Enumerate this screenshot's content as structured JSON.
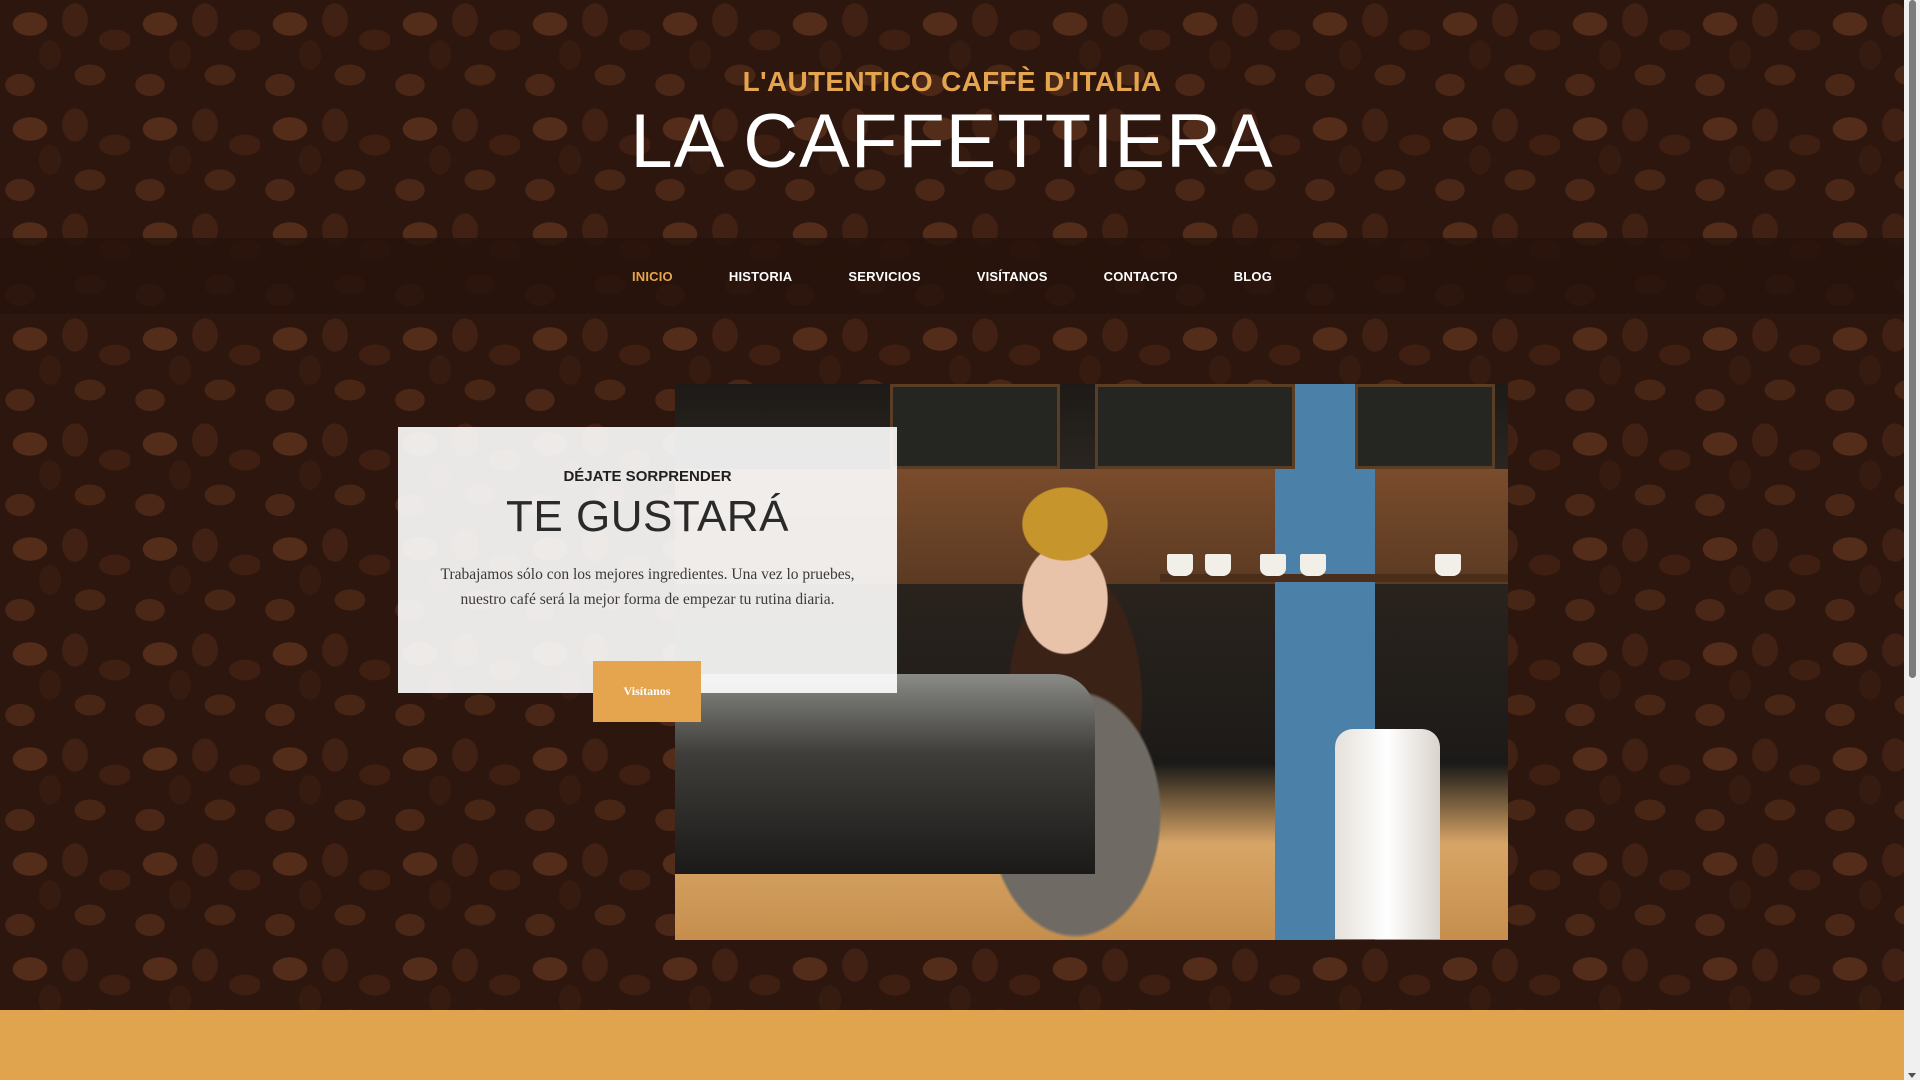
{
  "header": {
    "tagline": "L'AUTENTICO CAFFÈ D'ITALIA",
    "title": "LA CAFFETTIERA"
  },
  "nav": {
    "items": [
      {
        "label": "INICIO",
        "active": true
      },
      {
        "label": "HISTORIA",
        "active": false
      },
      {
        "label": "SERVICIOS",
        "active": false
      },
      {
        "label": "VISÍTANOS",
        "active": false
      },
      {
        "label": "CONTACTO",
        "active": false
      },
      {
        "label": "BLOG",
        "active": false
      }
    ]
  },
  "feature": {
    "kicker": "DÉJATE SORPRENDER",
    "title": "TE GUSTARÁ",
    "text": "Trabajamos sólo con los mejores ingredientes. Una vez lo pruebes, nuestro café será la mejor forma de empezar tu rutina diaria.",
    "button_label": "Visítanos"
  },
  "colors": {
    "accent": "#e5a54e",
    "nav_background": "#26120b",
    "card_background": "#ffffff",
    "footer_band": "#e0a44f"
  },
  "icons": {
    "background": "coffee-beans-background",
    "photo": "barista-photo"
  }
}
